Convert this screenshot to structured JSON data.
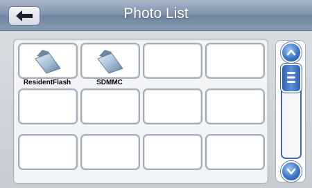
{
  "header": {
    "title": "Photo List",
    "back_icon": "left-arrow-icon"
  },
  "folders": [
    {
      "label": "ResidentFlash",
      "icon": "folder-icon"
    },
    {
      "label": "SDMMC",
      "icon": "folder-icon"
    }
  ],
  "empty_tiles": 10,
  "scrollbar": {
    "up_icon": "chevron-up-icon",
    "down_icon": "chevron-down-icon",
    "thumb_icon": "grip-lines-icon"
  },
  "colors": {
    "header": "#7f92ad",
    "accent": "#3b78c8"
  }
}
